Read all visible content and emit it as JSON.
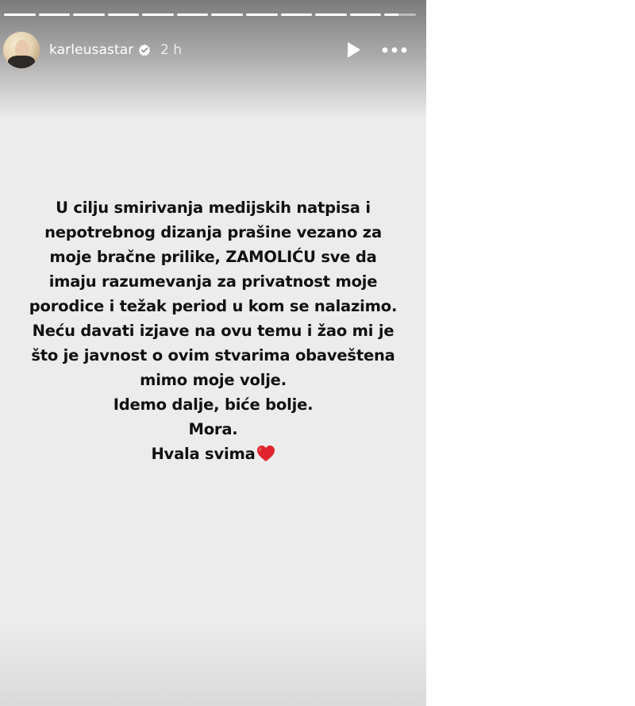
{
  "story": {
    "progress_segments": 12,
    "current_segment_index": 11,
    "current_segment_progress": 0.45,
    "background_color": "#ececec"
  },
  "header": {
    "username": "karleusastar",
    "verified_icon": "verified-badge-icon",
    "timestamp": "2 h",
    "play_icon": "play-icon",
    "more_icon": "more-options-icon"
  },
  "message": {
    "lines": [
      "U cilju smirivanja medijskih natpisa i",
      "nepotrebnog dizanja prašine vezano za",
      "moje bračne prilike, ZAMOLIĆU sve da",
      "imaju razumevanja za privatnost moje",
      "porodice i težak period u kom se nalazimo.",
      "Neću davati izjave na ovu temu i žao mi je",
      "što je javnost o ovim stvarima obaveštena",
      "mimo moje volje.",
      "Idemo dalje, biće bolje.",
      "Mora.",
      "Hvala svima"
    ],
    "emoji": "red-heart-icon",
    "heart_color": "#e0252e"
  }
}
